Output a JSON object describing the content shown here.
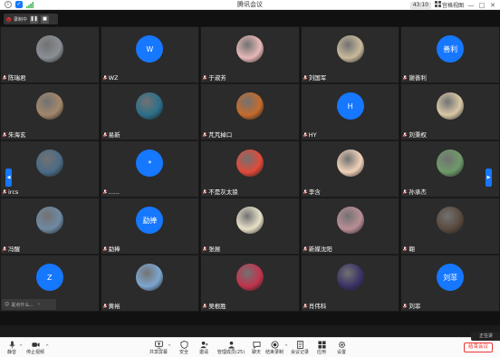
{
  "window": {
    "title": "腾讯会议",
    "timer": "43:10",
    "view_label": "宫格视图",
    "minimize": "—",
    "maximize": "□",
    "close": "✕"
  },
  "recording": {
    "label": "录制中"
  },
  "chat_bubble": {
    "text": "说点什么..."
  },
  "floating_panel": {
    "text": "正在讲"
  },
  "participants": [
    {
      "name": "陈瑞君",
      "kind": "photo",
      "color": "#8a8f95"
    },
    {
      "name": "WZ",
      "kind": "initial",
      "initial": "W",
      "color": "#1677ff"
    },
    {
      "name": "于淑芳",
      "kind": "photo",
      "color": "#e8b8b8"
    },
    {
      "name": "刘国军",
      "kind": "photo",
      "color": "#c9b99b"
    },
    {
      "name": "谢善利",
      "kind": "initial",
      "initial": "善利",
      "color": "#1677ff"
    },
    {
      "name": "朱海玄",
      "kind": "photo",
      "color": "#a3876b"
    },
    {
      "name": "易新",
      "kind": "photo",
      "color": "#2c6f8a"
    },
    {
      "name": "芃芃掉口",
      "kind": "photo",
      "color": "#c56b2c"
    },
    {
      "name": "HY",
      "kind": "initial",
      "initial": "H",
      "color": "#1677ff"
    },
    {
      "name": "刘秉权",
      "kind": "photo",
      "color": "#d9c8a6"
    },
    {
      "name": "ircs",
      "kind": "photo",
      "color": "#4b6b86"
    },
    {
      "name": "......",
      "kind": "initial",
      "initial": "*",
      "color": "#1677ff"
    },
    {
      "name": "不是灰太狼",
      "kind": "photo",
      "color": "#e04a3a"
    },
    {
      "name": "李含",
      "kind": "photo",
      "color": "#f1d2b9"
    },
    {
      "name": "孙承杰",
      "kind": "photo",
      "color": "#6f9a6a"
    },
    {
      "name": "冯醒",
      "kind": "photo",
      "color": "#6e8aa3"
    },
    {
      "name": "勐捧",
      "kind": "initial",
      "initial": "勐捧",
      "color": "#1677ff"
    },
    {
      "name": "张展",
      "kind": "photo",
      "color": "#e8e0c8"
    },
    {
      "name": "新媒沈阳",
      "kind": "photo",
      "color": "#b98e96"
    },
    {
      "name": "翱",
      "kind": "photo",
      "color": "#5a4a3e"
    },
    {
      "name": "Z·o'n'g",
      "kind": "initial",
      "initial": "Z",
      "color": "#1677ff"
    },
    {
      "name": "黄裕",
      "kind": "photo",
      "color": "#7da6cf"
    },
    {
      "name": "吴根胜",
      "kind": "photo",
      "color": "#c0344d"
    },
    {
      "name": "肖伟科",
      "kind": "photo",
      "color": "#3b3266"
    },
    {
      "name": "刘菲",
      "kind": "initial",
      "initial": "刘菲",
      "color": "#1677ff"
    }
  ],
  "toolbar": {
    "mute": "静音",
    "video": "停止视频",
    "share": "共享屏幕",
    "security": "安全",
    "invite": "邀请",
    "manage": "管理成员(25)",
    "chat": "聊天",
    "record": "结束录制",
    "subtitle": "会议记录",
    "apps": "应用",
    "settings": "设置",
    "leave": "结束会议"
  },
  "colors": {
    "accent": "#1677ff",
    "danger": "#e33333"
  }
}
